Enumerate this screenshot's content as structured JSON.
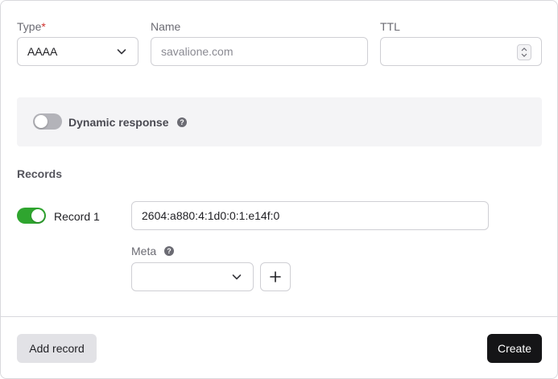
{
  "form": {
    "type": {
      "label": "Type",
      "required_mark": "*",
      "value": "AAAA"
    },
    "name": {
      "label": "Name",
      "value": "",
      "placeholder": "savalione.com"
    },
    "ttl": {
      "label": "TTL",
      "value": ""
    }
  },
  "dynamic_response": {
    "label": "Dynamic response",
    "enabled": false,
    "help_icon": "?"
  },
  "records": {
    "title": "Records",
    "items": [
      {
        "label": "Record 1",
        "enabled": true,
        "value": "2604:a880:4:1d0:0:1:e14f:0",
        "meta_label": "Meta",
        "meta_help_icon": "?",
        "meta_value": ""
      }
    ]
  },
  "footer": {
    "add_record_label": "Add record",
    "create_label": "Create"
  },
  "colors": {
    "toggle_on": "#2fa52f",
    "toggle_off": "#b3b3b9",
    "primary_button": "#151517",
    "required": "#d0312d"
  }
}
